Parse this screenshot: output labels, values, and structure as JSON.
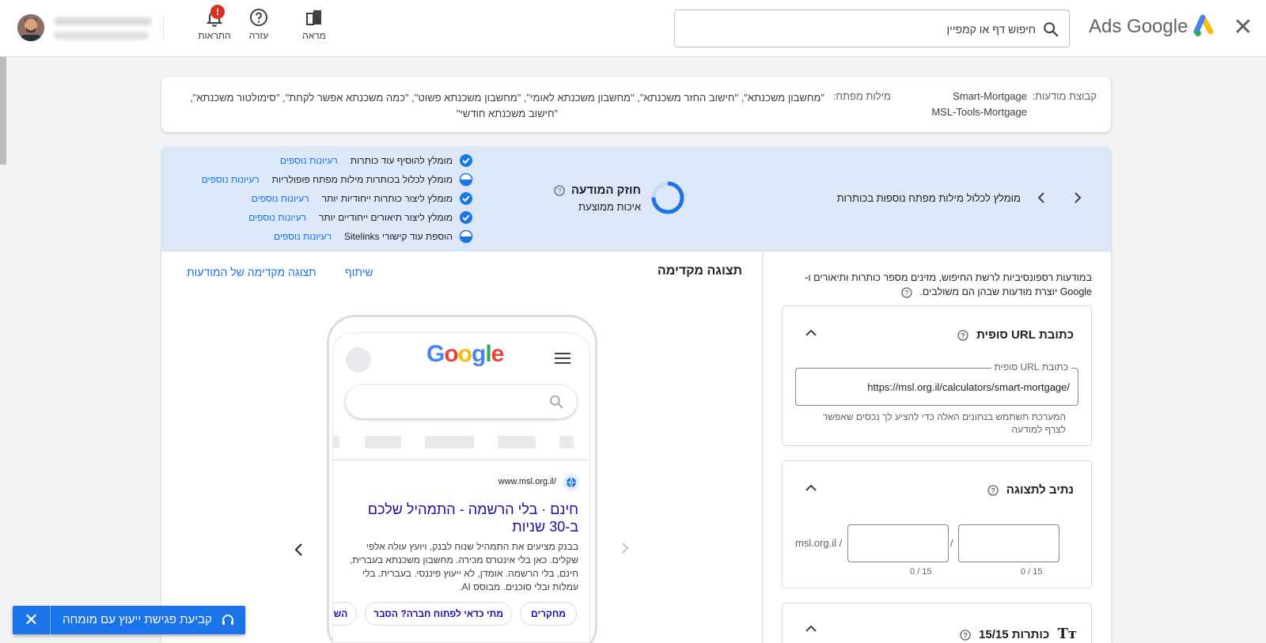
{
  "header": {
    "brand": "Ads Google",
    "search_placeholder": "חיפוש דף או קמפיין",
    "icons": [
      {
        "name": "appearance",
        "label": "מראה",
        "icon": "appearance-icon"
      },
      {
        "name": "help",
        "label": "עזרה",
        "icon": "help-icon"
      },
      {
        "name": "notifications",
        "label": "התראות",
        "icon": "bell-icon",
        "badge": "!"
      }
    ],
    "colors": {
      "accent": "#1a73e8",
      "alert": "#d93025"
    }
  },
  "keywords_card": {
    "adgroup_label": "קבוצת מודעות:",
    "adgroup_value_1": "Smart-Mortgage",
    "adgroup_value_2": "MSL-Tools-Mortgage",
    "keywords_label": "מילות מפתח:",
    "keywords_value": "\"מחשבון משכנתא\", \"חישוב החזר משכנתא\", \"מחשבון משכנתא לאומי\", \"מחשבון משכנתא פשוט\", \"כמה משכנתא אפשר לקחת\", \"סימולטור משכנתא\", \"חישוב משכנתא חודשי\""
  },
  "ad_strength": {
    "tip": "מומלץ לכלול מילות מפתח נוספות בכותרות",
    "title": "חוזק המודעה",
    "rating": "איכות ממוצעת",
    "recommendations": [
      {
        "text": "מומלץ להוסיף עוד כותרות",
        "link": "רעיונות נוספים",
        "status": "done"
      },
      {
        "text": "מומלץ לכלול בכותרות מילות מפתח פופולריות",
        "link": "רעיונות נוספים",
        "status": "partial"
      },
      {
        "text": "מומלץ ליצור כותרות ייחודיות יותר",
        "link": "רעיונות נוספים",
        "status": "done"
      },
      {
        "text": "מומלץ ליצור תיאורים ייחודיים יותר",
        "link": "רעיונות נוספים",
        "status": "done"
      },
      {
        "text": "הוספת עוד קישורי Sitelinks",
        "link": "רעיונות נוספים",
        "status": "partial"
      }
    ]
  },
  "preview": {
    "title": "תצוגה מקדימה",
    "share": "שיתוף",
    "ad_preview_link": "תצוגה מקדימה של המודעות",
    "phone": {
      "logo": "Google",
      "display_url": "www.msl.org.il/",
      "headline": "חינם · בלי הרשמה - התמהיל שלכם ב-30 שניות",
      "description": "בבנק מציעים את התמהיל שנוח לבנק, ויועץ עולה אלפי שקלים. כאן בלי אינטרס מכירה. מחשבון משכנתא בעברית, חינם, בלי הרשמה. אומדן, לא ייעוץ פיננסי. בעברית. בלי עמלות ובלי סוכנים. מבוסס AI.",
      "sitelinks": [
        "מחקרים",
        "מתי כדאי לפתוח חברה? הסבר",
        "השו"
      ]
    }
  },
  "editor": {
    "intro": "במודעות רספונסיביות לרשת החיפוש, מזינים מספר כותרות ותיאורים ו-Google יוצרת מודעות שבהן הם משולבים.",
    "final_url": {
      "title": "כתובת URL סופית",
      "field_label": "כתובת URL סופית",
      "value": "https://msl.org.il/calculators/smart-mortgage/",
      "hint": "המערכת תשתמש בנתונים האלה כדי להציע לך נכסים שאפשר לצרף למודעה"
    },
    "display_path": {
      "title": "נתיב לתצוגה",
      "domain": "msl.org.il /",
      "separator": "/",
      "path1_counter": "0 / 15",
      "path2_counter": "0 / 15"
    },
    "headlines": {
      "title": "כותרות 15/15"
    }
  },
  "expert_button": {
    "label": "קביעת פגישת ייעוץ עם מומחה"
  }
}
